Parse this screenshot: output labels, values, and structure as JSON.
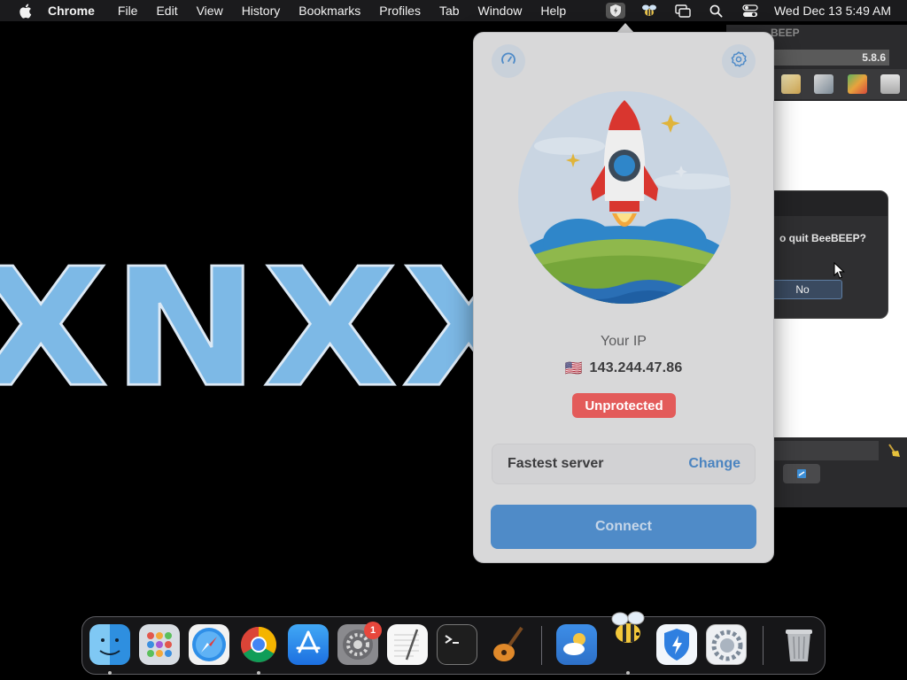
{
  "menubar": {
    "app_name": "Chrome",
    "menus": [
      "File",
      "Edit",
      "View",
      "History",
      "Bookmarks",
      "Profiles",
      "Tab",
      "Window",
      "Help"
    ],
    "clock": "Wed Dec 13  5:49 AM",
    "status_icons": [
      "vpn-shield-icon",
      "bee-icon",
      "screen-mirror-icon",
      "spotlight-search-icon",
      "control-center-icon"
    ]
  },
  "background": {
    "word": "XNXX"
  },
  "beebeep": {
    "title_fragment": "BEEP",
    "version": "5.8.6",
    "quit_prompt_fragment": "o quit BeeBEEP?",
    "no_label": "No"
  },
  "vpn": {
    "ip_label": "Your IP",
    "flag": "🇺🇸",
    "ip": "143.244.47.86",
    "status": "Unprotected",
    "server_label": "Fastest server",
    "change_label": "Change",
    "connect_label": "Connect",
    "colors": {
      "unprotected": "#e35b5a",
      "accent": "#4f8bc8",
      "link": "#4b84c0"
    }
  },
  "dock": {
    "apps": [
      "finder",
      "launchpad",
      "safari",
      "chrome",
      "app-store",
      "system-preferences",
      "textedit",
      "terminal",
      "garageband",
      "weather",
      "beebeep",
      "vpn",
      "settings",
      "trash"
    ],
    "update_badge": "1"
  }
}
